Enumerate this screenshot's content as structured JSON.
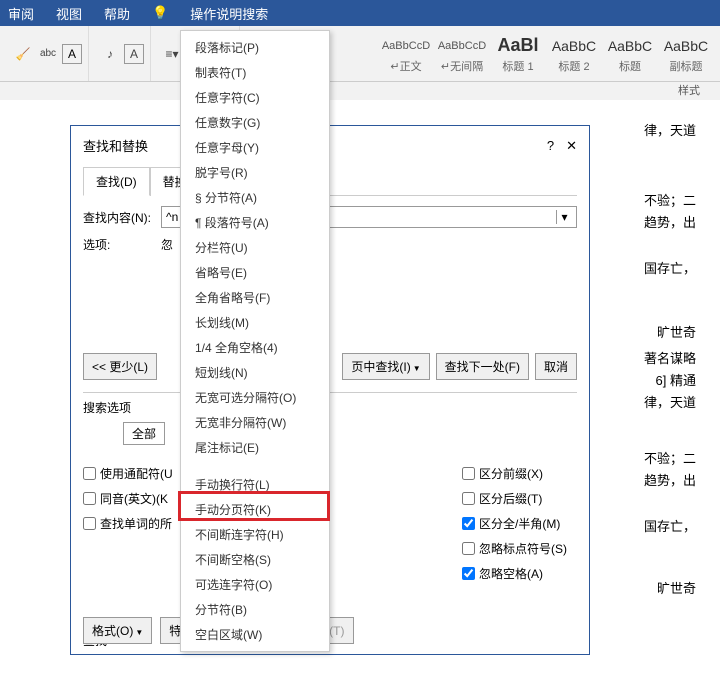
{
  "menubar": {
    "review": "审阅",
    "view": "视图",
    "help": "帮助",
    "search": "操作说明搜索"
  },
  "styles": {
    "items": [
      {
        "preview": "AaBbCcD",
        "label": "↵正文"
      },
      {
        "preview": "AaBbCcD",
        "label": "↵无间隔"
      },
      {
        "preview": "AaBl",
        "label": "标题 1"
      },
      {
        "preview": "AaBbC",
        "label": "标题 2"
      },
      {
        "preview": "AaBbC",
        "label": "标题"
      },
      {
        "preview": "AaBbC",
        "label": "副标题"
      }
    ],
    "caption": "样式"
  },
  "special_menu": [
    "段落标记(P)",
    "制表符(T)",
    "任意字符(C)",
    "任意数字(G)",
    "任意字母(Y)",
    "脱字号(R)",
    "§ 分节符(A)",
    "¶ 段落符号(A)",
    "分栏符(U)",
    "省略号(E)",
    "全角省略号(F)",
    "长划线(M)",
    "1/4 全角空格(4)",
    "短划线(N)",
    "无宽可选分隔符(O)",
    "无宽非分隔符(W)",
    "尾注标记(E)",
    "",
    "手动换行符(L)",
    "手动分页符(K)",
    "不间断连字符(H)",
    "不间断空格(S)",
    "可选连字符(O)",
    "分节符(B)",
    "空白区域(W)"
  ],
  "dialog": {
    "title": "查找和替换",
    "tab1": "查找(D)",
    "tab2": "替换(P",
    "find_label": "查找内容(N):",
    "find_value": "^n",
    "opt_label": "选项:",
    "opt_value": "忽",
    "less": "<< 更少(L)",
    "inreading": "页中查找(I)",
    "next": "查找下一处(F)",
    "cancel": "取消",
    "search_opt": "搜索选项",
    "all": "全部",
    "left_chk": [
      "使用通配符(U",
      "同音(英文)(K",
      "查找单词的所"
    ],
    "right_chk": [
      "区分前缀(X)",
      "区分后缀(T)",
      "区分全/半角(M)",
      "忽略标点符号(S)",
      "忽略空格(A)"
    ],
    "find_sec": "查找",
    "format": "格式(O)",
    "special": "特殊格式(E)",
    "nofmt": "不限定格式(T)"
  },
  "bg_text": {
    "t1": "律，天道",
    "t2": "不验；二",
    "t3": "趋势，出",
    "t4": "国存亡，",
    "t5": "旷世奇",
    "t6": "著名谋略",
    "t7": "6] 精通",
    "t8": "律，天道",
    "t9": "不验；二",
    "t10": "趋势，出",
    "t11": "国存亡，",
    "t12": "旷世奇"
  }
}
